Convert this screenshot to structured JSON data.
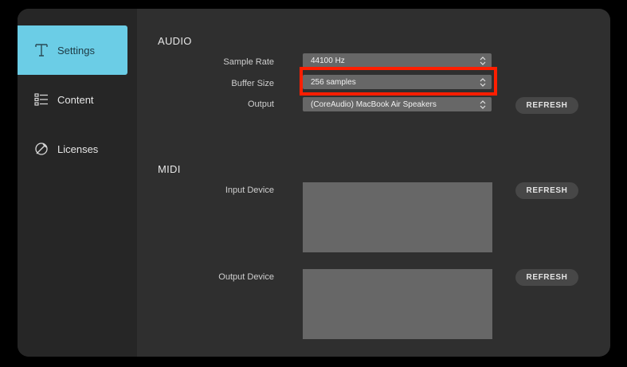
{
  "sidebar": {
    "items": [
      {
        "label": "Settings",
        "icon": "tuning-fork-icon",
        "active": true
      },
      {
        "label": "Content",
        "icon": "list-icon",
        "active": false
      },
      {
        "label": "Licenses",
        "icon": "license-icon",
        "active": false
      }
    ]
  },
  "audio": {
    "title": "AUDIO",
    "sample_rate": {
      "label": "Sample Rate",
      "value": "44100 Hz"
    },
    "buffer_size": {
      "label": "Buffer Size",
      "value": "256 samples"
    },
    "output": {
      "label": "Output",
      "value": "(CoreAudio) MacBook Air Speakers",
      "refresh_label": "REFRESH"
    }
  },
  "midi": {
    "title": "MIDI",
    "input_device": {
      "label": "Input Device",
      "refresh_label": "REFRESH"
    },
    "output_device": {
      "label": "Output Device",
      "refresh_label": "REFRESH"
    }
  },
  "colors": {
    "accent": "#6bcde6",
    "highlight": "#ff1e00",
    "background": "#2f2f2f"
  }
}
